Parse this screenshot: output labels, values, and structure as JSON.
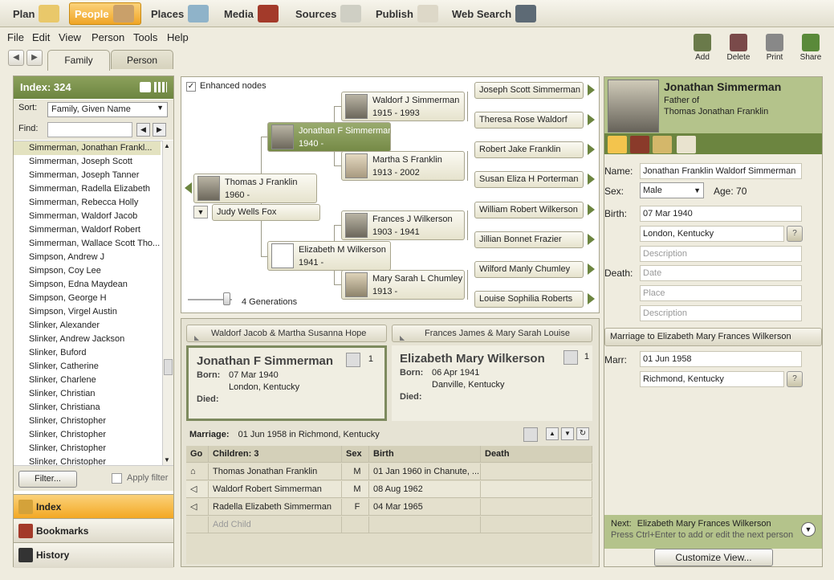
{
  "topnav": [
    {
      "label": "Plan",
      "icon": "plan-icon",
      "active": false
    },
    {
      "label": "People",
      "icon": "people-icon",
      "active": true
    },
    {
      "label": "Places",
      "icon": "places-icon",
      "active": false
    },
    {
      "label": "Media",
      "icon": "media-icon",
      "active": false
    },
    {
      "label": "Sources",
      "icon": "sources-icon",
      "active": false
    },
    {
      "label": "Publish",
      "icon": "publish-icon",
      "active": false
    },
    {
      "label": "Web Search",
      "icon": "binoculars-icon",
      "active": false
    }
  ],
  "menu": [
    "File",
    "Edit",
    "View",
    "Person",
    "Tools",
    "Help"
  ],
  "tools": [
    {
      "label": "Add",
      "icon": "add-person-icon"
    },
    {
      "label": "Delete",
      "icon": "delete-person-icon"
    },
    {
      "label": "Print",
      "icon": "print-icon"
    },
    {
      "label": "Share",
      "icon": "share-icon"
    }
  ],
  "tabs": {
    "family": "Family",
    "person": "Person"
  },
  "index": {
    "title": "Index: 324",
    "sort_label": "Sort:",
    "sort_value": "Family, Given Name",
    "find_label": "Find:",
    "names": [
      "Simmerman, Jonathan Frankl...",
      "Simmerman, Joseph Scott",
      "Simmerman, Joseph Tanner",
      "Simmerman, Radella Elizabeth",
      "Simmerman, Rebecca Holly",
      "Simmerman, Waldorf Jacob",
      "Simmerman, Waldorf Robert",
      "Simmerman, Wallace Scott Tho...",
      "Simpson, Andrew J",
      "Simpson, Coy Lee",
      "Simpson, Edna Maydean",
      "Simpson, George H",
      "Simpson, Virgel Austin",
      "Slinker, Alexander",
      "Slinker, Andrew Jackson",
      "Slinker, Buford",
      "Slinker, Catherine",
      "Slinker, Charlene",
      "Slinker, Christian",
      "Slinker, Christiana",
      "Slinker, Christopher",
      "Slinker, Christopher",
      "Slinker, Christopher",
      "Slinker, Christopher"
    ],
    "filter_button": "Filter...",
    "apply_filter": "Apply filter",
    "bottom_buttons": [
      "Index",
      "Bookmarks",
      "History"
    ]
  },
  "tree": {
    "enhanced_nodes": "Enhanced nodes",
    "generations": "4 Generations",
    "root": {
      "name": "Thomas J Franklin",
      "dates": "1960 -"
    },
    "spouse": "Judy Wells Fox",
    "father": {
      "name": "Jonathan F Simmerman",
      "dates": "1940 -"
    },
    "mother": {
      "name": "Elizabeth M Wilkerson",
      "dates": "1941 -"
    },
    "pgf": {
      "name": "Waldorf J Simmerman",
      "dates": "1915 - 1993"
    },
    "pgm": {
      "name": "Martha S Franklin",
      "dates": "1913 - 2002"
    },
    "mgf": {
      "name": "Frances J Wilkerson",
      "dates": "1903 - 1941"
    },
    "mgm": {
      "name": "Mary Sarah L Chumley",
      "dates": "1913 -"
    },
    "great": [
      "Joseph Scott Simmerman",
      "Theresa Rose Waldorf",
      "Robert Jake Franklin",
      "Susan Eliza H Porterman",
      "William Robert Wilkerson",
      "Jillian Bonnet Frazier",
      "Wilford Manly Chumley",
      "Louise Sophilia Roberts"
    ]
  },
  "family": {
    "left_parents": "Waldorf Jacob & Martha Susanna Hope",
    "right_parents": "Frances James & Mary Sarah Louise",
    "husband": {
      "name": "Jonathan F Simmerman",
      "born_date": "07 Mar 1940",
      "born_place": "London, Kentucky",
      "count": "1"
    },
    "wife": {
      "name": "Elizabeth Mary Wilkerson",
      "born_date": "06 Apr 1941",
      "born_place": "Danville, Kentucky",
      "count": "1"
    },
    "born_label": "Born:",
    "died_label": "Died:",
    "marriage_label": "Marriage:",
    "marriage_value": "01 Jun 1958 in Richmond, Kentucky",
    "children_headers": {
      "go": "Go",
      "children": "Children: 3",
      "sex": "Sex",
      "birth": "Birth",
      "death": "Death"
    },
    "children": [
      {
        "name": "Thomas Jonathan Franklin",
        "sex": "M",
        "birth": "01 Jan 1960 in Chanute, ...",
        "death": ""
      },
      {
        "name": "Waldorf Robert Simmerman",
        "sex": "M",
        "birth": "08 Aug 1962",
        "death": ""
      },
      {
        "name": "Radella Elizabeth Simmerman",
        "sex": "F",
        "birth": "04 Mar 1965",
        "death": ""
      }
    ],
    "add_child": "Add Child"
  },
  "person": {
    "name": "Jonathan Simmerman",
    "relation1": "Father of",
    "relation2": "Thomas Jonathan Franklin",
    "name_label": "Name:",
    "name_value": "Jonathan Franklin Waldorf Simmerman",
    "sex_label": "Sex:",
    "sex_value": "Male",
    "age": "Age: 70",
    "birth_label": "Birth:",
    "birth_date": "07 Mar 1940",
    "birth_place": "London, Kentucky",
    "description_ph": "Description",
    "death_label": "Death:",
    "date_ph": "Date",
    "place_ph": "Place",
    "marriage_header": "Marriage to Elizabeth Mary Frances Wilkerson",
    "marr_label": "Marr:",
    "marr_date": "01 Jun 1958",
    "marr_place": "Richmond, Kentucky",
    "next_label": "Next:",
    "next_name": "Elizabeth Mary Frances Wilkerson",
    "next_hint": "Press Ctrl+Enter to add or edit the next person",
    "customize": "Customize View..."
  }
}
